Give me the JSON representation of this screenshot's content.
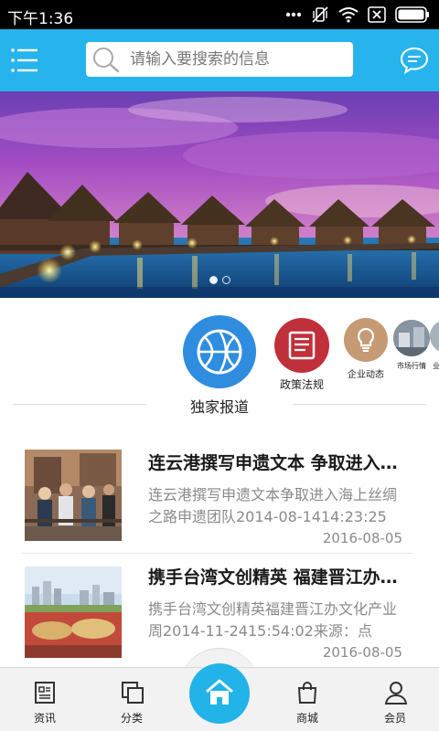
{
  "status_bar": {
    "time": "下午1:36"
  },
  "header": {
    "menu_icon": "menu-icon",
    "search_placeholder": "请输入要搜索的信息",
    "message_icon": "chat-bubble-icon"
  },
  "banner": {
    "slide_count": 2,
    "active_slide": 1
  },
  "categories": [
    {
      "label": "独家报道",
      "icon": "basketball-icon",
      "color": "#2f8de0"
    },
    {
      "label": "政策法规",
      "icon": "document-icon",
      "color": "#c0303a"
    },
    {
      "label": "企业动态",
      "icon": "lightbulb-icon",
      "color": "#c59a74"
    },
    {
      "label": "市场行情",
      "icon": "market-photo-icon",
      "color": "#7d8a98"
    },
    {
      "label": "业",
      "icon": "partial-icon",
      "color": "#9aa4ae"
    }
  ],
  "news": [
    {
      "title": "连云港撰写申遗文本 争取进入海上丝绸之路申遗团队",
      "summary": "连云港撰写申遗文本争取进入海上丝绸之路申遗团队2014-08-1414:23:25",
      "date": "2016-08-05"
    },
    {
      "title": "携手台湾文创精英 福建晋江办文化产业周",
      "summary": "携手台湾文创精英福建晋江办文化产业周2014-11-2415:54:02来源：点",
      "date": "2016-08-05"
    }
  ],
  "bottom_nav": {
    "items": [
      {
        "label": "资讯",
        "icon": "news-icon"
      },
      {
        "label": "分类",
        "icon": "category-icon"
      },
      {
        "label": "",
        "icon": "home-icon"
      },
      {
        "label": "商城",
        "icon": "shopping-bag-icon"
      },
      {
        "label": "会员",
        "icon": "user-icon"
      }
    ],
    "accent": "#22b3e9"
  }
}
